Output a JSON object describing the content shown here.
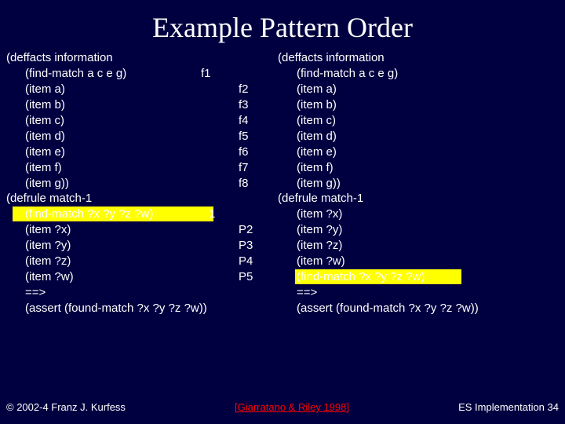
{
  "title": "Example Pattern Order",
  "left": {
    "l0": "(deffacts information",
    "l1": "(find-match a c e g)",
    "l2": "(item a)",
    "l3": "(item b)",
    "l4": "(item c)",
    "l5": "(item d)",
    "l6": "(item e)",
    "l7": "(item f)",
    "l8": "(item g))",
    "l9": "(defrule match-1",
    "l10": "(find-match ?x ?y ?z ?w)",
    "l11": "(item ?x)",
    "l12": "(item ?y)",
    "l13": "(item ?z)",
    "l14": "(item ?w)",
    "l15": "==>",
    "l16": "(assert (found-match ?x ?y ?z ?w))"
  },
  "labels": {
    "f1": "f1",
    "f2": "f2",
    "f3": "f3",
    "f4": "f4",
    "f5": "f5",
    "f6": "f6",
    "f7": "f7",
    "f8": "f8",
    "p1": "1",
    "p2": "P2",
    "p3": "P3",
    "p4": "P4",
    "p5": "P5"
  },
  "right": {
    "r0": "(deffacts information",
    "r1": "(find-match a c e g)",
    "r2": "(item a)",
    "r3": "(item b)",
    "r4": "(item c)",
    "r5": "(item d)",
    "r6": "(item e)",
    "r7": "(item f)",
    "r8": "(item g))",
    "r9": "(defrule match-1",
    "r10": "(item ?x)",
    "r11": "(item ?y)",
    "r12": "(item ?z)",
    "r13": "(item ?w)",
    "r14": "(find-match ?x ?y ?z ?w)",
    "r15": "==>",
    "r16": "(assert (found-match ?x ?y ?z ?w))"
  },
  "footer": {
    "copyright": "© 2002-4 Franz J. Kurfess",
    "citation": "[Giarratano & Riley 1998]",
    "pagenum": "ES Implementation 34"
  }
}
